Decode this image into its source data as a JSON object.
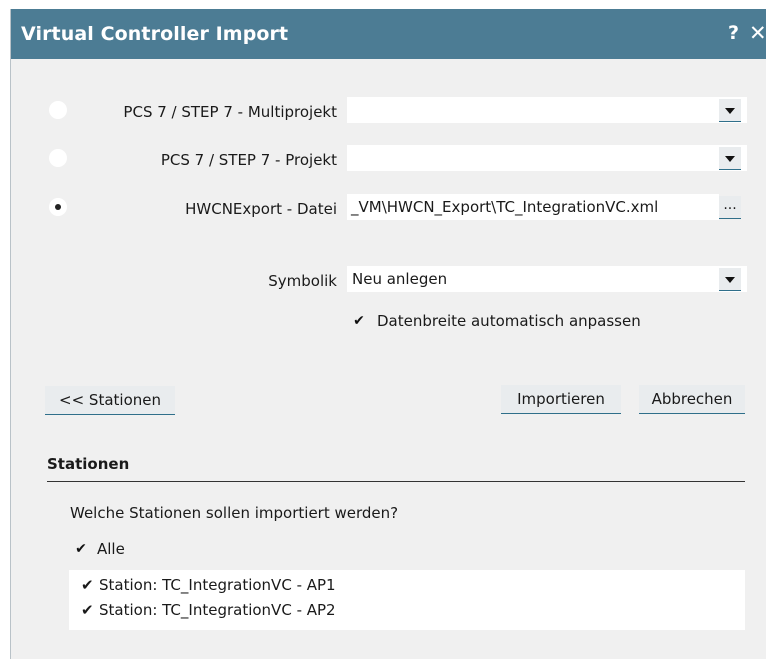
{
  "dialog": {
    "title": "Virtual Controller Import",
    "help_label": "?",
    "close_label": "✕"
  },
  "source": {
    "options": [
      {
        "label": "PCS 7 / STEP 7 - Multiprojekt",
        "selected": false,
        "value": ""
      },
      {
        "label": "PCS 7 / STEP 7 - Projekt",
        "selected": false,
        "value": ""
      },
      {
        "label": "HWCNExport - Datei",
        "selected": true,
        "value": "_VM\\HWCN_Export\\TC_IntegrationVC.xml"
      }
    ],
    "browse_label": "..."
  },
  "symbolik": {
    "label": "Symbolik",
    "value": "Neu anlegen"
  },
  "datenbreite": {
    "label": "Datenbreite automatisch anpassen",
    "checked": true
  },
  "buttons": {
    "stations": "<< Stationen",
    "import": "Importieren",
    "cancel": "Abbrechen"
  },
  "stations": {
    "section_title": "Stationen",
    "question": "Welche Stationen sollen importiert werden?",
    "all_label": "Alle",
    "all_checked": true,
    "items": [
      {
        "label": "Station:  TC_IntegrationVC - AP1",
        "checked": true
      },
      {
        "label": "Station:  TC_IntegrationVC - AP2",
        "checked": true
      }
    ]
  },
  "colors": {
    "titlebar": "#4c7c94",
    "dialog_bg": "#f0f0f0",
    "button_accent": "#2f6f8a"
  }
}
